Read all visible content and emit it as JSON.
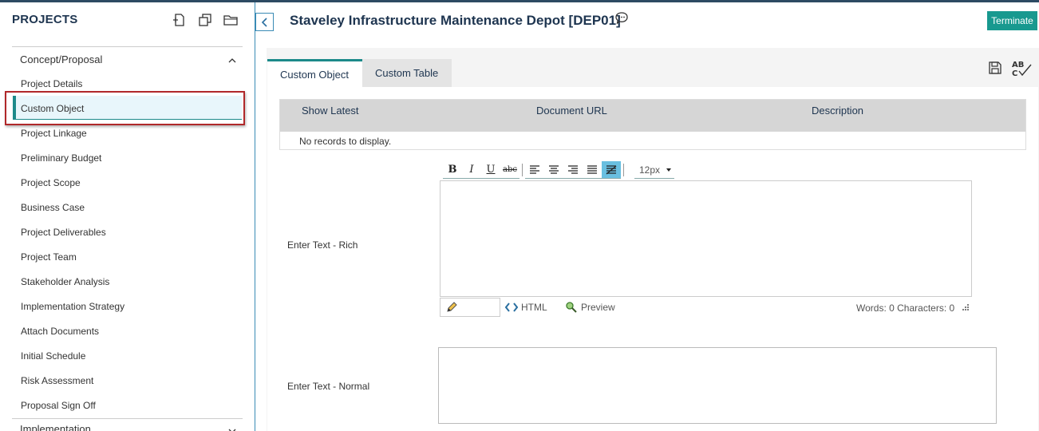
{
  "sidebar": {
    "title": "PROJECTS",
    "section": "Concept/Proposal",
    "items": [
      {
        "label": "Project Details"
      },
      {
        "label": "Custom Object"
      },
      {
        "label": "Project Linkage"
      },
      {
        "label": "Preliminary Budget"
      },
      {
        "label": "Project Scope"
      },
      {
        "label": "Business Case"
      },
      {
        "label": "Project Deliverables"
      },
      {
        "label": "Project Team"
      },
      {
        "label": "Stakeholder Analysis"
      },
      {
        "label": "Implementation Strategy"
      },
      {
        "label": "Attach Documents"
      },
      {
        "label": "Initial Schedule"
      },
      {
        "label": "Risk Assessment"
      },
      {
        "label": "Proposal Sign Off"
      }
    ],
    "active_item": "Custom Object",
    "next_section": "Implementation",
    "icons": [
      "new-document-icon",
      "copy-icon",
      "folder-icon"
    ]
  },
  "header": {
    "title": "Staveley Infrastructure Maintenance Depot [DEP01]",
    "terminate_label": "Terminate"
  },
  "tabs": [
    {
      "label": "Custom Object",
      "active": true
    },
    {
      "label": "Custom Table",
      "active": false
    }
  ],
  "grid": {
    "columns": [
      "Show Latest",
      "Document URL",
      "Description"
    ],
    "empty_text": "No records to display."
  },
  "fields": {
    "rich_label": "Enter Text - Rich",
    "normal_label": "Enter Text - Normal"
  },
  "editor": {
    "font_size": "12px",
    "html_label": "HTML",
    "preview_label": "Preview",
    "counts": "Words: 0   Characters: 0"
  },
  "colors": {
    "accent": "#18998f",
    "title": "#1e3550",
    "selection_border": "#b0282a"
  }
}
